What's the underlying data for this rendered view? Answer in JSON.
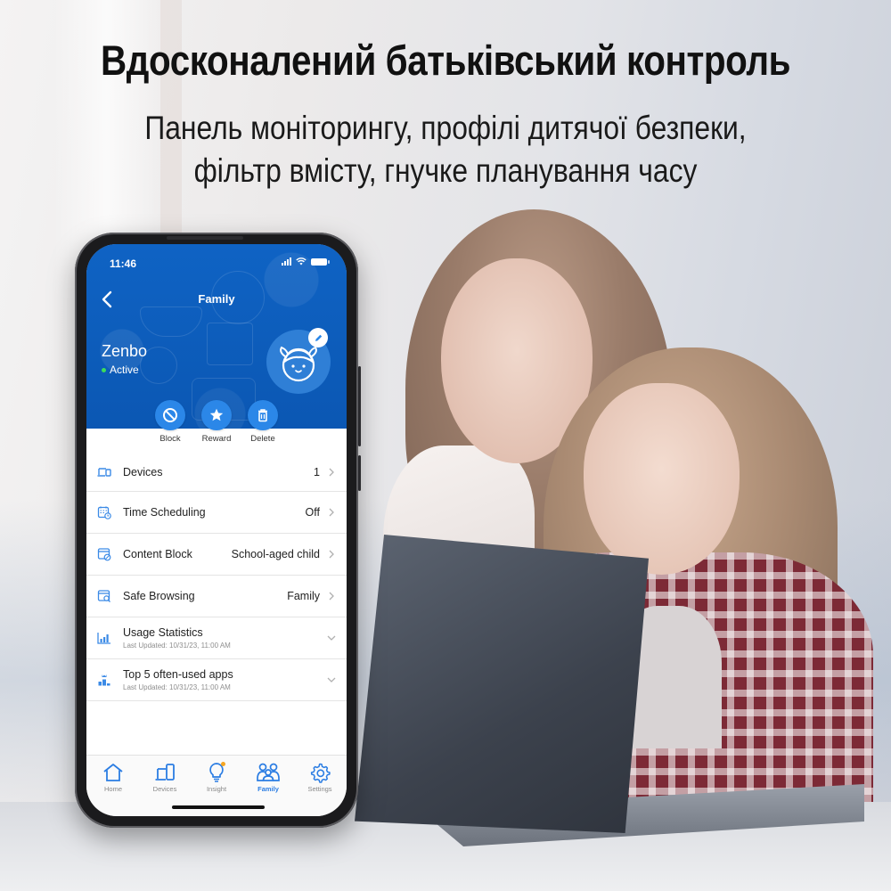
{
  "banner": {
    "headline": "Вдосконалений батьківський контроль",
    "subline_1": "Панель моніторингу, профілі дитячої безпеки,",
    "subline_2": "фільтр вмісту, гнучке планування часу"
  },
  "phone": {
    "status_bar": {
      "time": "11:46",
      "icons": [
        "signal-icon",
        "wifi-icon",
        "battery-icon"
      ]
    },
    "nav": {
      "back_icon": "chevron-left-icon",
      "title": "Family"
    },
    "profile": {
      "name": "Zenbo",
      "status": "Active",
      "status_color": "#3ddc5a",
      "avatar_icon": "child-face-icon",
      "edit_icon": "pencil-icon"
    },
    "actions": [
      {
        "label": "Block",
        "icon": "block-icon"
      },
      {
        "label": "Reward",
        "icon": "star-icon"
      },
      {
        "label": "Delete",
        "icon": "trash-icon"
      }
    ],
    "list": [
      {
        "label": "Devices",
        "value": "1",
        "icon": "devices-icon",
        "trailing": "chevron-right-icon"
      },
      {
        "label": "Time Scheduling",
        "value": "Off",
        "icon": "calendar-clock-icon",
        "trailing": "chevron-right-icon"
      },
      {
        "label": "Content Block",
        "value": "School-aged child",
        "icon": "content-block-icon",
        "trailing": "chevron-right-icon"
      },
      {
        "label": "Safe Browsing",
        "value": "Family",
        "icon": "safe-browsing-icon",
        "trailing": "chevron-right-icon"
      },
      {
        "label": "Usage Statistics",
        "sub": "Last Updated: 10/31/23, 11:00 AM",
        "icon": "bar-chart-icon",
        "trailing": "chevron-down-icon"
      },
      {
        "label": "Top 5 often-used apps",
        "sub": "Last Updated: 10/31/23, 11:00 AM",
        "icon": "ranking-icon",
        "trailing": "chevron-down-icon"
      }
    ],
    "tabs": [
      {
        "label": "Home",
        "icon": "home-icon",
        "active": false
      },
      {
        "label": "Devices",
        "icon": "devices-icon",
        "active": false
      },
      {
        "label": "Insight",
        "icon": "lightbulb-icon",
        "active": false,
        "badge": true
      },
      {
        "label": "Family",
        "icon": "family-icon",
        "active": true
      },
      {
        "label": "Settings",
        "icon": "gear-icon",
        "active": false
      }
    ]
  },
  "colors": {
    "brand_blue": "#0d5fc0",
    "accent_blue": "#2b87e8",
    "active_tab": "#2b7de3",
    "insight_badge": "#f5a623",
    "status_active": "#3ddc5a"
  }
}
